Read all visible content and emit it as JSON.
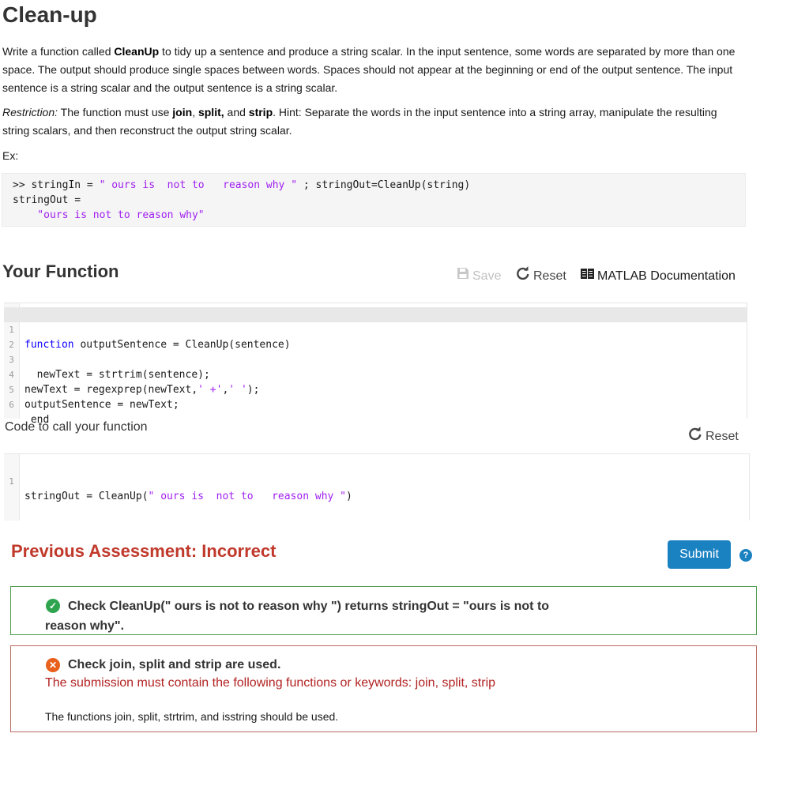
{
  "problem": {
    "title": "Clean-up",
    "description": {
      "p1_before": "Write a function called ",
      "p1_bold": "CleanUp",
      "p1_after": " to tidy up a sentence and produce a string scalar. In the input sentence, some words are separated by more than one space. The output should produce single spaces between words. Spaces should not appear at the beginning or end of the output sentence. The input sentence is a string scalar and the output sentence is a string scalar.",
      "restriction_label": "Restriction:",
      "restriction_text1": " The function must use ",
      "kw_join": "join",
      "sep1": ", ",
      "kw_split": "split,",
      "sep2": " and ",
      "kw_strip": "strip",
      "restriction_text2": ".   Hint: Separate the words in the input sentence into a string array, manipulate the resulting string scalars, and then reconstruct the output string scalar.",
      "example_label": "Ex:"
    },
    "example": {
      "line1_a": ">> stringIn = ",
      "line1_str": "\" ours is  not to   reason why \"",
      "line1_b": " ; stringOut=CleanUp(string)",
      "line2": "stringOut =",
      "line3_str": "    \"ours is not to reason why\""
    }
  },
  "your_function": {
    "heading": "Your Function",
    "toolbar": {
      "save_label": "Save",
      "reset_label": "Reset",
      "docs_label": "MATLAB Documentation"
    },
    "code_lines": [
      {
        "n": "1",
        "kw": "function",
        "rest": " outputSentence = CleanUp(sentence)"
      },
      {
        "n": "2",
        "text": ""
      },
      {
        "n": "3",
        "text": "  newText = strtrim(sentence);"
      },
      {
        "n": "4",
        "a": "newText = regexprep(newText,",
        "s1": "' +'",
        "b": ",",
        "s2": "' '",
        "c": ");"
      },
      {
        "n": "5",
        "text": "outputSentence = newText;"
      },
      {
        "n": "6",
        "kw": " end"
      }
    ]
  },
  "call_function": {
    "label": "Code to call your function",
    "reset_label": "Reset",
    "code_line": {
      "n": "1",
      "a": "stringOut = CleanUp(",
      "s": "\" ours is  not to   reason why \"",
      "b": ")"
    }
  },
  "assessment": {
    "heading": "Previous Assessment: Incorrect",
    "submit_label": "Submit",
    "help_icon": "?",
    "tests": [
      {
        "status": "pass",
        "title": "Check CleanUp(\" ours is not to reason why \") returns stringOut = \"ours is not to reason why\"."
      },
      {
        "status": "fail",
        "title": "Check join, split and strip are used.",
        "error": "The submission must contain the following functions or keywords: join, split, strip",
        "note": "The functions join, split, strtrim, and isstring should be used."
      }
    ]
  },
  "colors": {
    "accent": "#1b82c2",
    "incorrect": "#c0392b",
    "pass": "#2ea44f",
    "fail": "#e8601c",
    "string": "#a020f0",
    "keyword": "#0e00ff"
  }
}
